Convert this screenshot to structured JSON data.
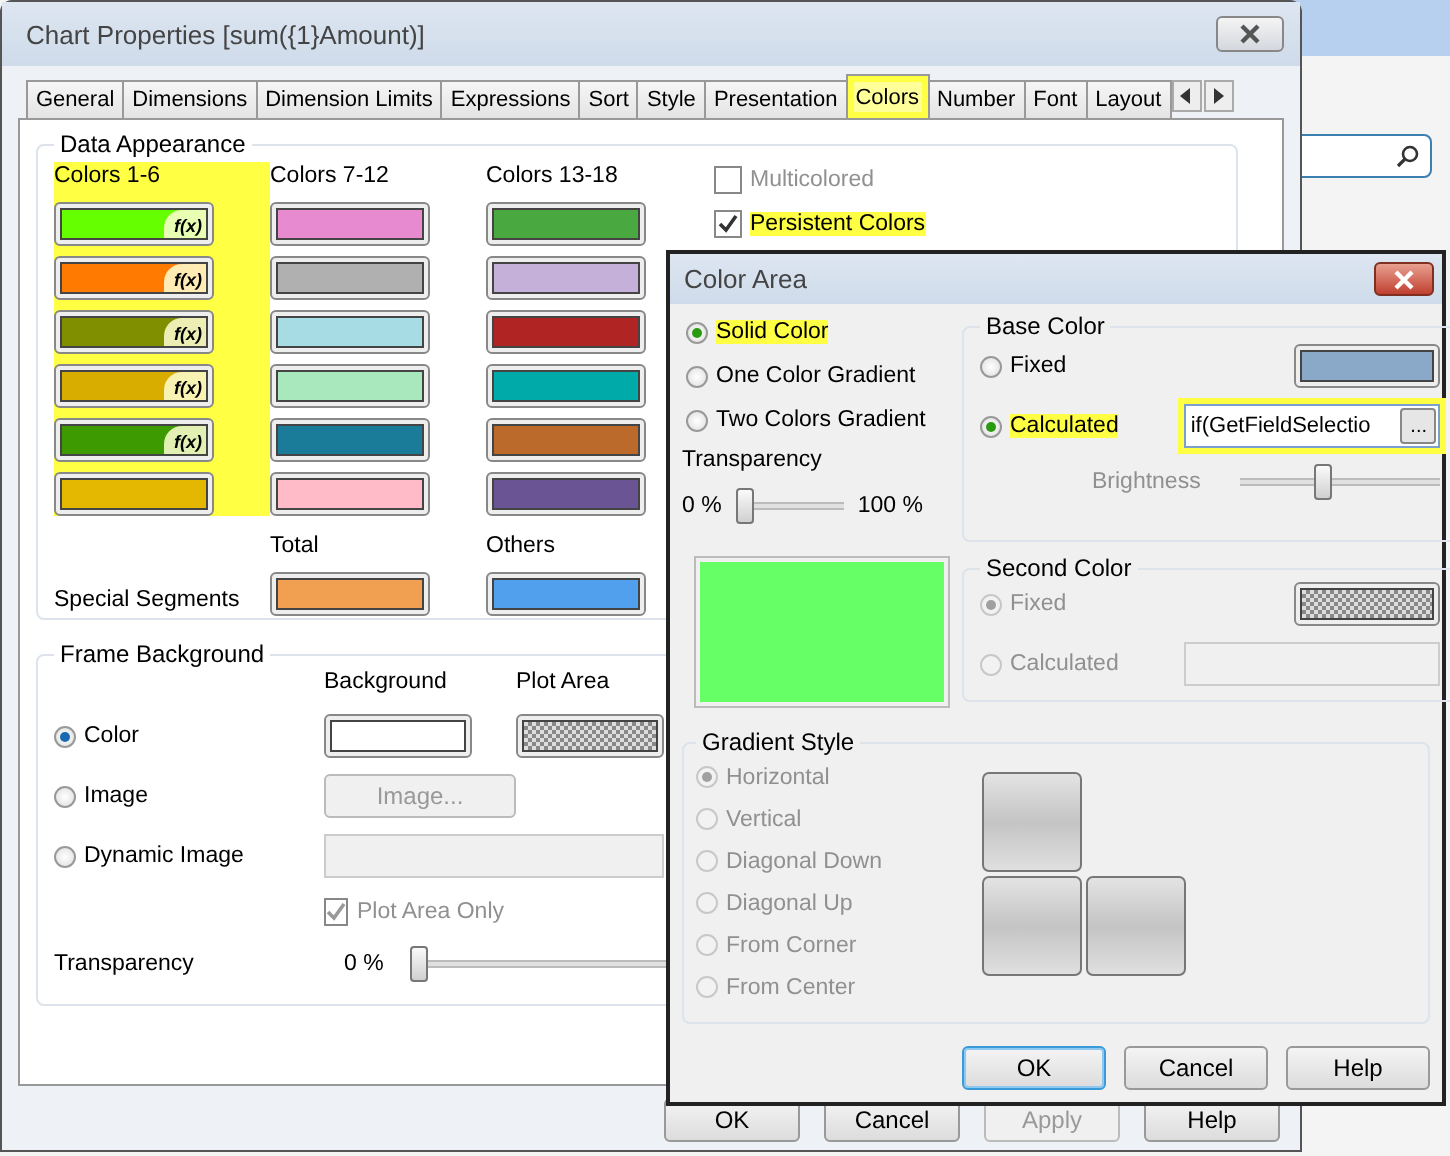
{
  "main_window": {
    "title": "Chart Properties [sum({1}Amount)]"
  },
  "tabs": [
    {
      "label": "General",
      "selected": false,
      "highlighted": false
    },
    {
      "label": "Dimensions",
      "selected": false,
      "highlighted": false
    },
    {
      "label": "Dimension Limits",
      "selected": false,
      "highlighted": false
    },
    {
      "label": "Expressions",
      "selected": false,
      "highlighted": false
    },
    {
      "label": "Sort",
      "selected": false,
      "highlighted": false
    },
    {
      "label": "Style",
      "selected": false,
      "highlighted": false
    },
    {
      "label": "Presentation",
      "selected": false,
      "highlighted": false
    },
    {
      "label": "Colors",
      "selected": true,
      "highlighted": true
    },
    {
      "label": "Number",
      "selected": false,
      "highlighted": false
    },
    {
      "label": "Font",
      "selected": false,
      "highlighted": false
    },
    {
      "label": "Layout",
      "selected": false,
      "highlighted": false
    }
  ],
  "data_appearance": {
    "title": "Data Appearance",
    "columns": [
      {
        "heading": "Colors 1-6",
        "highlighted": true,
        "swatches": [
          {
            "color": "#66ff00",
            "badge": "f(x)"
          },
          {
            "color": "#ff7a00",
            "badge": "f(x)"
          },
          {
            "color": "#7f8f00",
            "badge": "f(x)"
          },
          {
            "color": "#d8ad00",
            "badge": "f(x)"
          },
          {
            "color": "#3d9a00",
            "badge": "f(x)"
          },
          {
            "color": "#e4b800"
          }
        ]
      },
      {
        "heading": "Colors 7-12",
        "highlighted": false,
        "swatches": [
          {
            "color": "#e88ad0"
          },
          {
            "color": "#b0b0b0"
          },
          {
            "color": "#a8dce4"
          },
          {
            "color": "#a8e8bc"
          },
          {
            "color": "#1a7c98"
          },
          {
            "color": "#ffbcc8"
          }
        ]
      },
      {
        "heading": "Colors 13-18",
        "highlighted": false,
        "swatches": [
          {
            "color": "#4aa840"
          },
          {
            "color": "#c4b0d8"
          },
          {
            "color": "#b02424"
          },
          {
            "color": "#00aaa8"
          },
          {
            "color": "#bc6a2c"
          },
          {
            "color": "#6a5494"
          }
        ]
      }
    ],
    "special_segments": {
      "label": "Special Segments",
      "items": [
        {
          "heading": "Total",
          "color": "#f0a050"
        },
        {
          "heading": "Others",
          "color": "#50a0ee"
        }
      ]
    },
    "options": [
      {
        "label": "Multicolored",
        "checked": false,
        "disabled": true,
        "highlighted": false
      },
      {
        "label": "Persistent Colors",
        "checked": true,
        "disabled": false,
        "highlighted": true
      }
    ]
  },
  "frame_background": {
    "title": "Frame Background",
    "background_label": "Background",
    "plot_area_label": "Plot Area",
    "modes": [
      {
        "label": "Color",
        "selected": true
      },
      {
        "label": "Image",
        "selected": false
      },
      {
        "label": "Dynamic Image",
        "selected": false
      }
    ],
    "image_button": {
      "label": "Image...",
      "disabled": true
    },
    "plot_area_only": {
      "label": "Plot Area Only",
      "checked": true,
      "disabled": true
    },
    "transparency": {
      "label": "Transparency",
      "reading": "0 %",
      "level": 0
    }
  },
  "buttons": [
    {
      "label": "OK",
      "disabled": false
    },
    {
      "label": "Cancel",
      "disabled": false
    },
    {
      "label": "Apply",
      "disabled": true
    },
    {
      "label": "Help",
      "disabled": false
    }
  ],
  "color_area": {
    "title": "Color Area",
    "fill_modes": [
      {
        "label": "Solid Color",
        "selected": true,
        "highlighted": true
      },
      {
        "label": "One Color Gradient",
        "selected": false,
        "highlighted": false
      },
      {
        "label": "Two Colors Gradient",
        "selected": false,
        "highlighted": false
      }
    ],
    "transparency": {
      "label": "Transparency",
      "min": "0 %",
      "max": "100 %",
      "level": 0
    },
    "preview": {
      "color": "#66ff66"
    },
    "base_color": {
      "title": "Base Color",
      "options": [
        {
          "label": "Fixed",
          "selected": false,
          "highlighted": false,
          "kind": "swatch",
          "color": "#8aa8c8"
        },
        {
          "label": "Calculated",
          "selected": true,
          "highlighted": true,
          "kind": "expression",
          "value": "if(GetFieldSelectio",
          "button": "..."
        }
      ],
      "brightness": {
        "label": "Brightness",
        "disabled": true,
        "level": 0.4
      }
    },
    "second_color": {
      "title": "Second Color",
      "options": [
        {
          "label": "Fixed",
          "selected": true,
          "disabled": true,
          "kind": "pattern"
        },
        {
          "label": "Calculated",
          "selected": false,
          "disabled": true,
          "kind": "expression"
        }
      ]
    },
    "gradient_style": {
      "title": "Gradient Style",
      "options": [
        {
          "label": "Horizontal",
          "selected": true,
          "disabled": true
        },
        {
          "label": "Vertical",
          "selected": false,
          "disabled": true
        },
        {
          "label": "Diagonal Down",
          "selected": false,
          "disabled": true
        },
        {
          "label": "Diagonal Up",
          "selected": false,
          "disabled": true
        },
        {
          "label": "From Corner",
          "selected": false,
          "disabled": true
        },
        {
          "label": "From Center",
          "selected": false,
          "disabled": true
        }
      ]
    },
    "buttons": [
      {
        "label": "OK",
        "default": true
      },
      {
        "label": "Cancel",
        "default": false
      },
      {
        "label": "Help",
        "default": false
      }
    ]
  }
}
